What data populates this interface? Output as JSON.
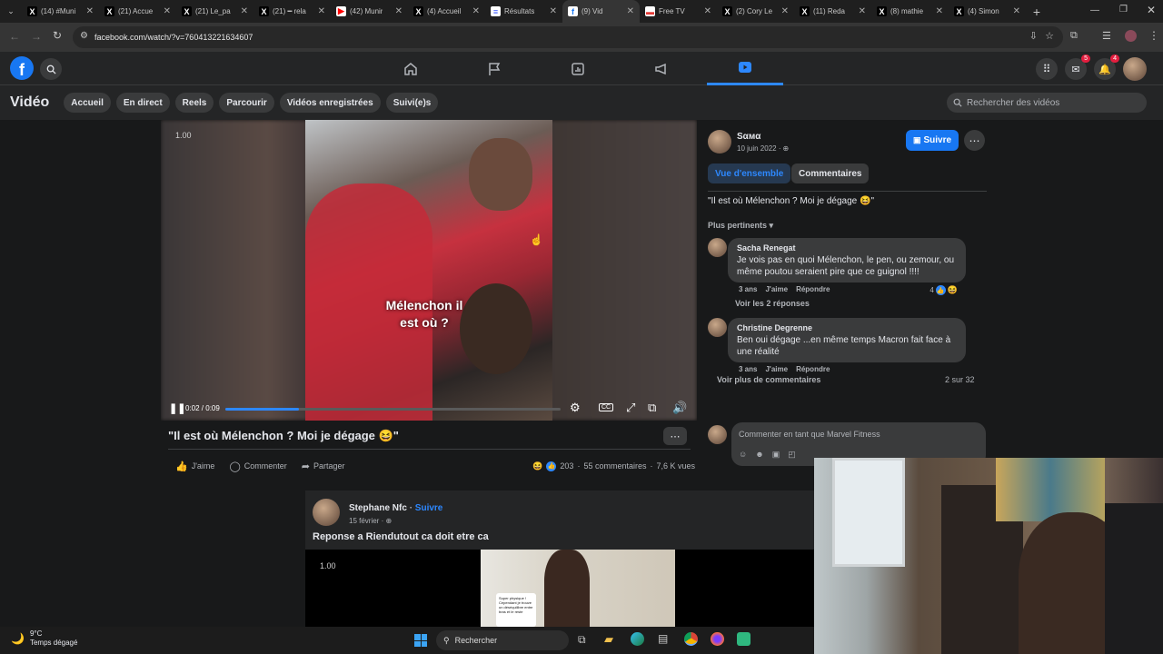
{
  "browser": {
    "tabs": [
      {
        "label": "(14) #Muni",
        "icon": "x-logo"
      },
      {
        "label": "(21) Accue",
        "icon": "x-logo"
      },
      {
        "label": "(21) Le_pa",
        "icon": "x-logo"
      },
      {
        "label": "(21) ━ rela",
        "icon": "x-logo"
      },
      {
        "label": "(42) Munir",
        "icon": "youtube-logo"
      },
      {
        "label": "(4) Accueil",
        "icon": "x-logo"
      },
      {
        "label": "Résultats",
        "icon": "flag"
      },
      {
        "label": "(9) Vid",
        "icon": "facebook-logo"
      },
      {
        "label": "Free TV",
        "icon": "tv"
      },
      {
        "label": "(2) Cory Le",
        "icon": "x-logo"
      },
      {
        "label": "(11) Reda",
        "icon": "x-logo"
      },
      {
        "label": "(8) mathie",
        "icon": "x-logo"
      },
      {
        "label": "(4) Simon",
        "icon": "x-logo"
      }
    ],
    "active_tab_index": 7,
    "url": "facebook.com/watch/?v=760413221634607"
  },
  "fbnav": {
    "messenger_badge": "5",
    "notifications_badge": "4"
  },
  "video_header": {
    "title": "Vidéo",
    "pills": [
      "Accueil",
      "En direct",
      "Reels",
      "Parcourir",
      "Vidéos enregistrées",
      "Suivi(e)s"
    ],
    "search_placeholder": "Rechercher des vidéos"
  },
  "player": {
    "speed": "1.00",
    "caption_line1": "Mélenchon il",
    "caption_line2": "est où ?",
    "time": "0:02 / 0:09",
    "progress": 0.22
  },
  "video_info": {
    "title": "\"Il est où Mélenchon ? Moi je dégage 😆\"",
    "like_label": "J'aime",
    "comment_label": "Commenter",
    "share_label": "Partager",
    "reaction_count": "203",
    "comments_count": "55 commentaires",
    "views": "7,6 K vues"
  },
  "panel": {
    "author": "Sαмα",
    "date": "10 juin 2022 · ",
    "follow_label": "Suivre",
    "tab_overview": "Vue d'ensemble",
    "tab_comments": "Commentaires",
    "caption": "\"Il est où Mélenchon ? Moi je dégage 😆\"",
    "sort_label": "Plus pertinents",
    "comments": [
      {
        "name": "Sacha Renegat",
        "text": "Je vois pas en quoi Mélenchon, le pen, ou zemour, ou même poutou seraient pire que ce guignol !!!!",
        "age": "3 ans",
        "like": "J'aime",
        "reply": "Répondre",
        "reactions": "4"
      },
      {
        "name": "Christine Degrenne",
        "text": "Ben oui dégage ...en même temps Macron fait face à une réalité",
        "age": "3 ans",
        "like": "J'aime",
        "reply": "Répondre"
      }
    ],
    "see_replies": "Voir les 2 réponses",
    "see_more": "Voir plus de commentaires",
    "pager": "2 sur 32",
    "comment_as": "Commenter en tant que Marvel Fitness"
  },
  "post2": {
    "author": "Stephane Nfc",
    "follow": "Suivre",
    "date": "15 février · ",
    "text": "Reponse a Riendutout ca doit etre ca",
    "speed": "1.00",
    "thumb_text": "Super physique ! Cependant je trouve un déséquilibre entre bras et le reste"
  },
  "taskbar": {
    "weather_temp": "9°C",
    "weather_desc": "Temps dégagé",
    "search_label": "Rechercher"
  }
}
